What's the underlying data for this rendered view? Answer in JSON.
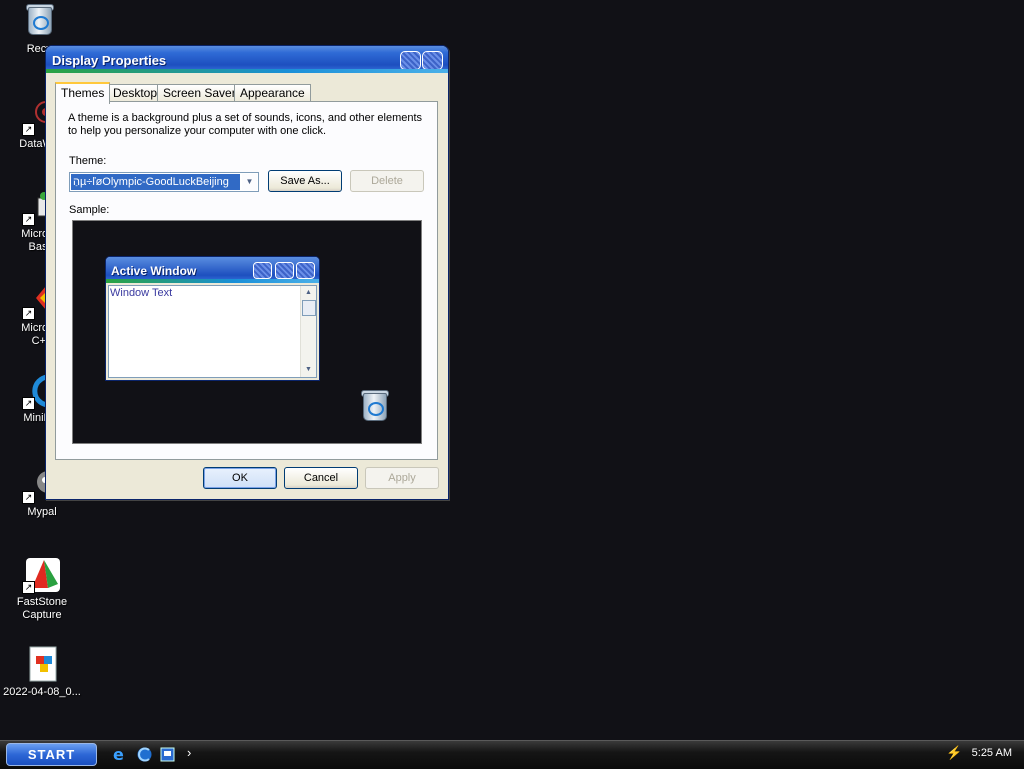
{
  "desktop": {
    "icons": [
      {
        "label": "Recyc",
        "icon": "recycle-bin-icon"
      },
      {
        "label": "DataWag",
        "icon": "datawag-icon"
      },
      {
        "label": "Microsof\nBasic",
        "icon": "ms-basic-icon"
      },
      {
        "label": "Microsof\nC++",
        "icon": "ms-cpp-icon"
      },
      {
        "label": "MiniBro",
        "icon": "minibrowser-icon"
      },
      {
        "label": "Mypal",
        "icon": "mypal-icon"
      },
      {
        "label": "FastStone\nCapture",
        "icon": "faststone-capture-icon"
      },
      {
        "label": "2022-04-08_0...",
        "icon": "image-file-icon"
      }
    ]
  },
  "window": {
    "title": "Display Properties",
    "tabs": [
      "Themes",
      "Desktop",
      "Screen Saver",
      "Appearance"
    ],
    "active_tab": "Themes",
    "description": "A theme is a background plus a set of sounds, icons, and other elements to help you personalize your computer with one click.",
    "theme_label": "Theme:",
    "theme_value": "הַµ÷ľøOlympic-GoodLuckBeijing",
    "save_as_label": "Save As...",
    "delete_label": "Delete",
    "sample_label": "Sample:",
    "sample": {
      "window_title": "Active Window",
      "window_text": "Window Text"
    },
    "ok_label": "OK",
    "cancel_label": "Cancel",
    "apply_label": "Apply"
  },
  "taskbar": {
    "start_label": "START",
    "quick_launch": [
      "internet-explorer-icon",
      "minibrowser-icon",
      "show-desktop-icon"
    ],
    "chevron": "›",
    "clock": "5:25 AM"
  }
}
